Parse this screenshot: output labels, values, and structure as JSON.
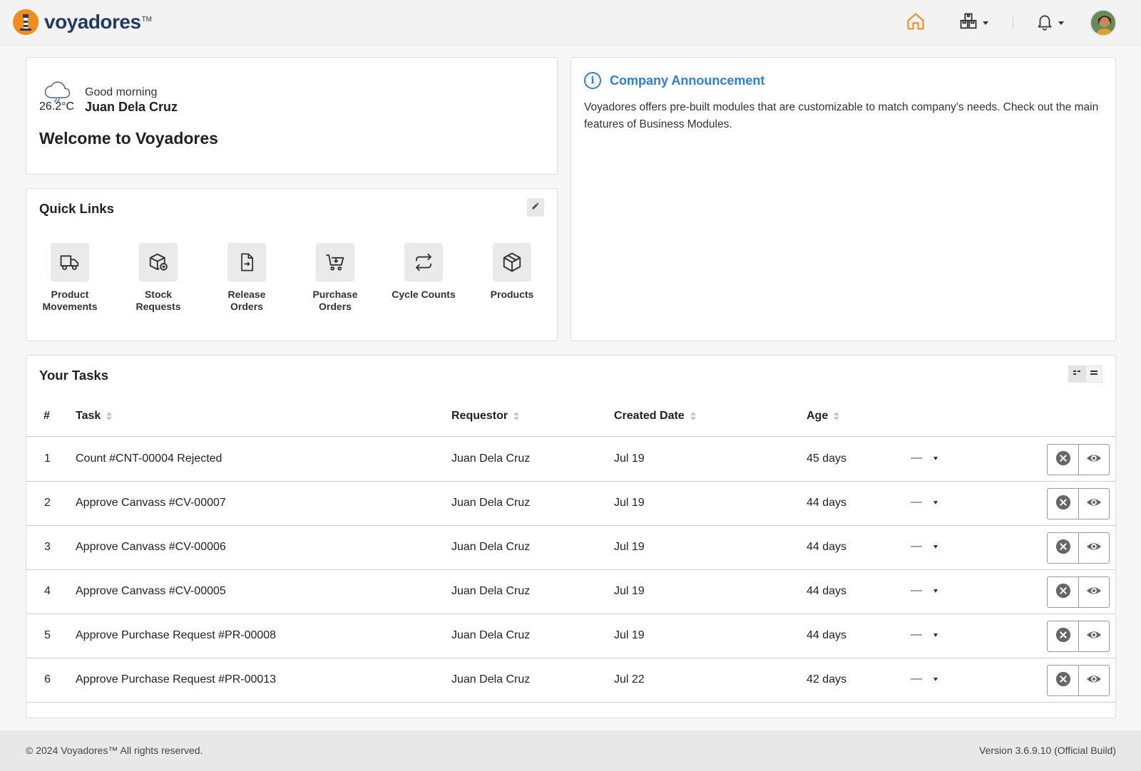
{
  "brand": {
    "name": "voyadores",
    "tm": "TM"
  },
  "nav": {
    "icons": [
      "home-icon",
      "warehouse-icon",
      "bell-icon"
    ],
    "accent": "#f28c1b"
  },
  "welcome": {
    "temperature": "26.2°C",
    "greeting": "Good morning",
    "user_name": "Juan Dela Cruz",
    "title": "Welcome to Voyadores"
  },
  "announcement": {
    "title": "Company Announcement",
    "body": "Voyadores offers pre-built modules that are customizable to match company's needs. Check out the main features of Business Modules."
  },
  "quick_links": {
    "title": "Quick Links",
    "items": [
      {
        "label": "Product Movements",
        "icon": "truck-icon"
      },
      {
        "label": "Stock Requests",
        "icon": "box-add-icon"
      },
      {
        "label": "Release Orders",
        "icon": "document-export-icon"
      },
      {
        "label": "Purchase Orders",
        "icon": "cart-icon"
      },
      {
        "label": "Cycle Counts",
        "icon": "cycle-icon"
      },
      {
        "label": "Products",
        "icon": "package-icon"
      }
    ]
  },
  "tasks": {
    "title": "Your Tasks",
    "columns": [
      "#",
      "Task",
      "Requestor",
      "Created Date",
      "Age"
    ],
    "rows": [
      {
        "num": "1",
        "task": "Count #CNT-00004 Rejected",
        "requestor": "Juan Dela Cruz",
        "created": "Jul 19",
        "age": "45 days",
        "status": "—"
      },
      {
        "num": "2",
        "task": "Approve Canvass #CV-00007",
        "requestor": "Juan Dela Cruz",
        "created": "Jul 19",
        "age": "44 days",
        "status": "—"
      },
      {
        "num": "3",
        "task": "Approve Canvass #CV-00006",
        "requestor": "Juan Dela Cruz",
        "created": "Jul 19",
        "age": "44 days",
        "status": "—"
      },
      {
        "num": "4",
        "task": "Approve Canvass #CV-00005",
        "requestor": "Juan Dela Cruz",
        "created": "Jul 19",
        "age": "44 days",
        "status": "—"
      },
      {
        "num": "5",
        "task": "Approve Purchase Request #PR-00008",
        "requestor": "Juan Dela Cruz",
        "created": "Jul 19",
        "age": "44 days",
        "status": "—"
      },
      {
        "num": "6",
        "task": "Approve Purchase Request #PR-00013",
        "requestor": "Juan Dela Cruz",
        "created": "Jul 22",
        "age": "42 days",
        "status": "—"
      }
    ]
  },
  "footer": {
    "copyright": "© 2024 Voyadores™ All rights reserved.",
    "version": "Version 3.6.9.10 (Official Build)"
  }
}
